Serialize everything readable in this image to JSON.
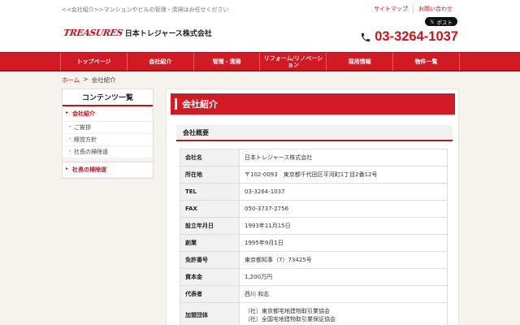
{
  "header": {
    "top_breadcrumb": "<<会社紹介>>マンションやビルの管理・清掃はお任せください",
    "logo_mark": "TREASURES",
    "logo_text": "日本トレジャース株式会社",
    "links": [
      "サイトマップ",
      "お問い合わせ"
    ],
    "post_label": "ポスト",
    "phone": "03-3264-1037"
  },
  "nav": {
    "items": [
      "トップページ",
      "会社紹介",
      "管理・清掃",
      "リフォーム/リノベーション",
      "採用情報",
      "物件一覧"
    ]
  },
  "breadcrumb": {
    "home": "ホーム",
    "sep": ">",
    "current": "会社紹介"
  },
  "sidebar": {
    "title": "コンテンツ一覧",
    "item1": "会社紹介",
    "subs": [
      "ご挨拶",
      "経営方針",
      "社長の掃除道"
    ],
    "item2": "社長の掃除道"
  },
  "main": {
    "title": "会社紹介",
    "section": "会社概要",
    "rows": [
      {
        "label": "会社名",
        "value": "日本トレジャース株式会社"
      },
      {
        "label": "所在地",
        "value": "〒102-0093　東京都千代田区平河町1丁目2番12号"
      },
      {
        "label": "TEL",
        "value": "03-3264-1037"
      },
      {
        "label": "FAX",
        "value": "050-3737-2756"
      },
      {
        "label": "設立年月日",
        "value": "1993年11月15日"
      },
      {
        "label": "創業",
        "value": "1995年9月1日"
      },
      {
        "label": "免許番号",
        "value": "東京都知事（7）73425号"
      },
      {
        "label": "資本金",
        "value": "1,200万円"
      },
      {
        "label": "代表者",
        "value": "西川 和志"
      }
    ],
    "groups_label": "加盟団体",
    "groups": [
      "（社）東京都宅地建物取引業協会",
      "（社）全国宅地建物取引業保証協会"
    ]
  }
}
